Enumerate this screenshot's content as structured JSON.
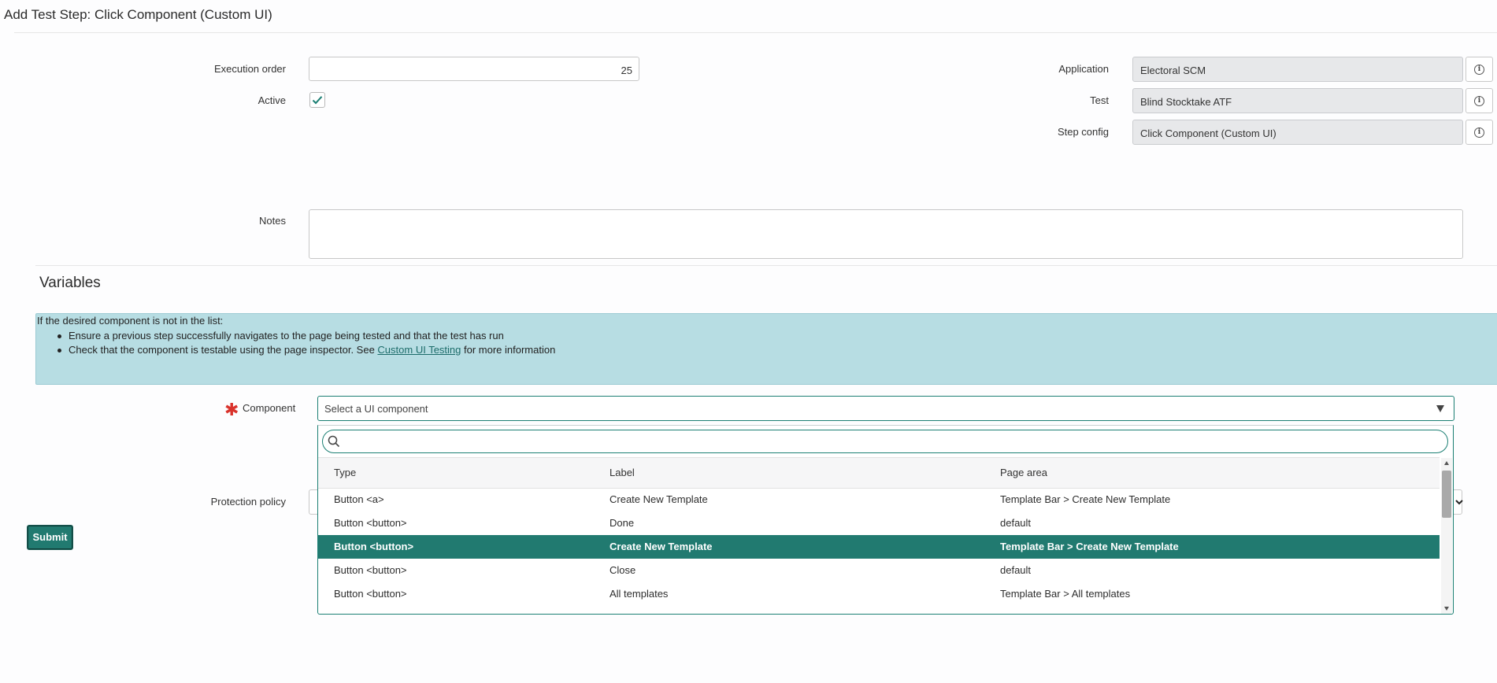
{
  "page": {
    "title": "Add Test Step: Click Component (Custom UI)"
  },
  "form": {
    "execution_order": {
      "label": "Execution order",
      "value": "25"
    },
    "active": {
      "label": "Active",
      "checked": true
    },
    "application": {
      "label": "Application",
      "value": "Electoral SCM"
    },
    "test": {
      "label": "Test",
      "value": "Blind Stocktake ATF"
    },
    "step_config": {
      "label": "Step config",
      "value": "Click Component (Custom UI)"
    },
    "notes": {
      "label": "Notes",
      "value": ""
    }
  },
  "variables": {
    "title": "Variables",
    "info": {
      "intro": "If the desired component is not in the list:",
      "bullet1": "Ensure a previous step successfully navigates to the page being tested and that the test has run",
      "bullet2_pre": "Check that the component is testable using the page inspector. See ",
      "bullet2_link": "Custom UI Testing",
      "bullet2_post": " for more information"
    },
    "component": {
      "label": "Component",
      "required_mark": "✱",
      "placeholder": "Select a UI component",
      "dropdown": {
        "search_value": "",
        "columns": [
          "Type",
          "Label",
          "Page area"
        ],
        "rows": [
          {
            "type": "Button <a>",
            "label": "Create New Template",
            "area": "Template Bar > Create New Template",
            "selected": false
          },
          {
            "type": "Button <button>",
            "label": "Done",
            "area": "default",
            "selected": false
          },
          {
            "type": "Button <button>",
            "label": "Create New Template",
            "area": "Template Bar > Create New Template",
            "selected": true
          },
          {
            "type": "Button <button>",
            "label": "Close",
            "area": "default",
            "selected": false
          },
          {
            "type": "Button <button>",
            "label": "All templates",
            "area": "Template Bar > All templates",
            "selected": false
          }
        ]
      }
    },
    "protection_policy": {
      "label": "Protection policy",
      "value": ""
    }
  },
  "actions": {
    "submit_label": "Submit"
  },
  "icons": {
    "info": "info-icon",
    "check": "check-icon",
    "search": "search-icon",
    "caret": "caret-down-icon"
  },
  "colors": {
    "accent": "#217a70",
    "info_bg": "#b7dde3",
    "required": "#d9322b"
  }
}
